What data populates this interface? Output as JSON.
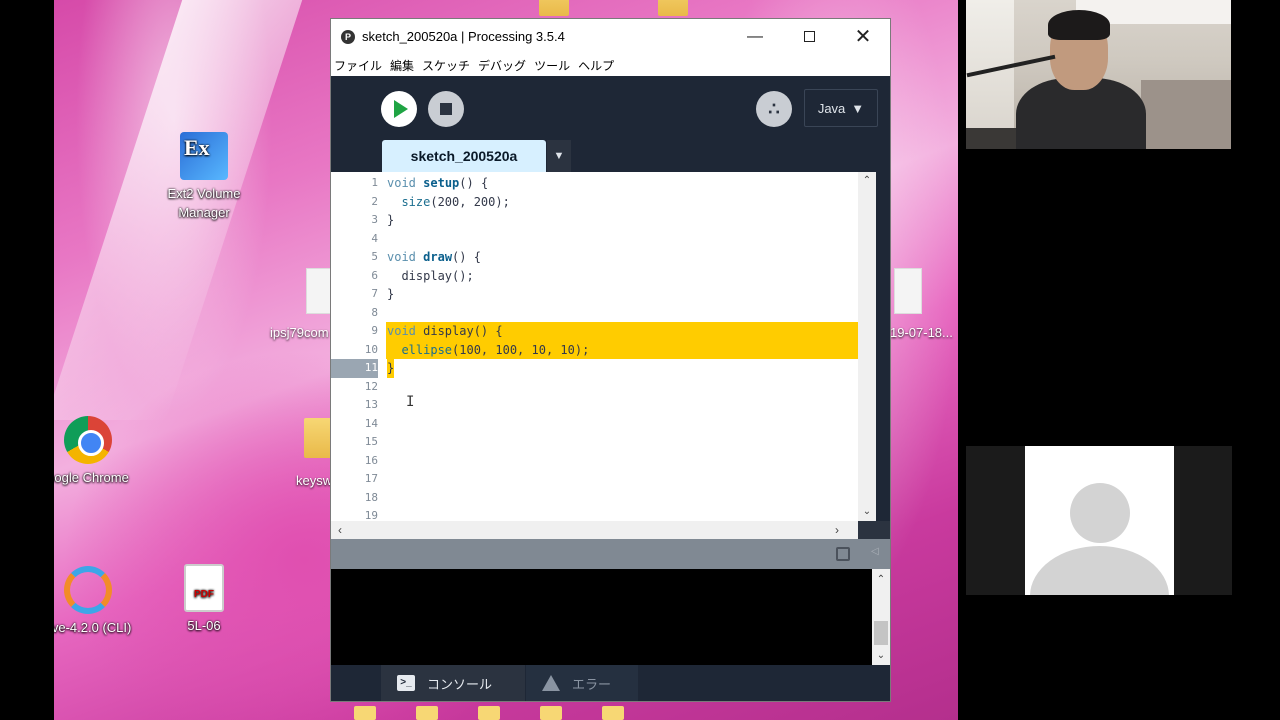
{
  "window": {
    "title": "sketch_200520a | Processing 3.5.4",
    "app_icon_glyph": "P"
  },
  "menu": [
    "ファイル",
    "編集",
    "スケッチ",
    "デバッグ",
    "ツール",
    "ヘルプ"
  ],
  "toolbar": {
    "mode_label": "Java",
    "debug_glyph": "꒰꒱"
  },
  "tab": {
    "name": "sketch_200520a",
    "menu_glyph": "▼"
  },
  "editor": {
    "lines": [
      {
        "n": "1",
        "parts": [
          [
            "kw",
            "void"
          ],
          [
            "",
            " "
          ],
          [
            "fn",
            "setup"
          ],
          [
            "",
            "() {"
          ]
        ]
      },
      {
        "n": "2",
        "parts": [
          [
            "",
            "  "
          ],
          [
            "fn2",
            "size"
          ],
          [
            "",
            "(200, 200);"
          ]
        ]
      },
      {
        "n": "3",
        "parts": [
          [
            "",
            "}"
          ]
        ]
      },
      {
        "n": "4",
        "parts": []
      },
      {
        "n": "5",
        "parts": [
          [
            "kw",
            "void"
          ],
          [
            "",
            " "
          ],
          [
            "fn",
            "draw"
          ],
          [
            "",
            "() {"
          ]
        ]
      },
      {
        "n": "6",
        "parts": [
          [
            "",
            "  display();"
          ]
        ]
      },
      {
        "n": "7",
        "parts": [
          [
            "",
            "}"
          ]
        ]
      },
      {
        "n": "8",
        "parts": []
      },
      {
        "n": "9",
        "parts": [
          [
            "kw",
            "void"
          ],
          [
            "",
            " display() {"
          ]
        ],
        "highlight": true
      },
      {
        "n": "10",
        "parts": [
          [
            "",
            "  "
          ],
          [
            "fn2",
            "ellipse"
          ],
          [
            "",
            "(100, 100, 10, 10);"
          ]
        ],
        "highlight": true
      },
      {
        "n": "11",
        "parts": [
          [
            "",
            "}"
          ]
        ],
        "highlight_brace": true,
        "current": true
      },
      {
        "n": "12",
        "parts": []
      },
      {
        "n": "13",
        "parts": []
      },
      {
        "n": "14",
        "parts": []
      },
      {
        "n": "15",
        "parts": []
      },
      {
        "n": "16",
        "parts": []
      },
      {
        "n": "17",
        "parts": []
      },
      {
        "n": "18",
        "parts": []
      },
      {
        "n": "19",
        "parts": []
      }
    ],
    "highlight_color": "#ffcc00"
  },
  "bottom_tabs": {
    "console": "コンソール",
    "errors": "エラー"
  },
  "desktop": {
    "icons": {
      "ext2": "Ext2 Volume Manager",
      "chrome": "oogle Chrome",
      "octave": "ave-4.2.0 (CLI)",
      "pdf": "5L-06",
      "pdf_badge": "PDF"
    },
    "partial_labels": {
      "ipsj": "ipsj79com",
      "keys": "keysw",
      "date": "19-07-18..."
    }
  }
}
